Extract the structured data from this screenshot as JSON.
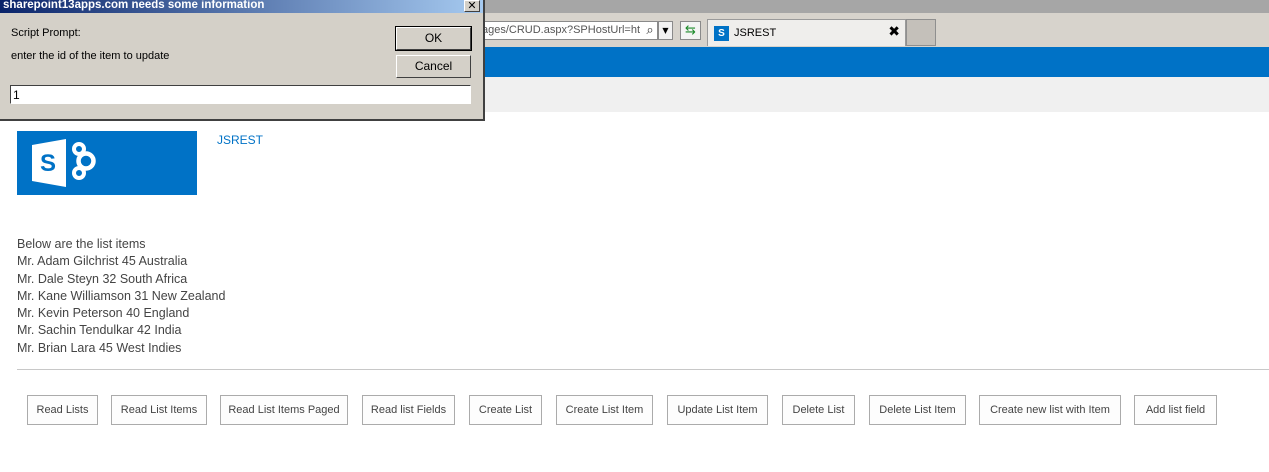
{
  "browser": {
    "address_text": "ages/CRUD.aspx?SPHostUrl=ht",
    "tab_title": "JSREST",
    "tab_icon": "S"
  },
  "page": {
    "site_title": "JSREST",
    "logo_letter": "S",
    "list_heading": "Below are the list items",
    "list_items": [
      "Mr. Adam Gilchrist 45 Australia",
      "Mr. Dale Steyn 32 South Africa",
      "Mr. Kane Williamson 31 New Zealand",
      "Mr. Kevin Peterson 40 England",
      "Mr. Sachin Tendulkar 42 India",
      "Mr. Brian Lara 45 West Indies"
    ],
    "buttons": [
      "Read Lists",
      "Read List Items",
      "Read List Items Paged",
      "Read list Fields",
      "Create List",
      "Create List Item",
      "Update List Item",
      "Delete List",
      "Delete List Item",
      "Create new list with Item",
      "Add list field"
    ]
  },
  "dialog": {
    "title": "sharepoint13apps.com needs some information",
    "prompt_label": "Script Prompt:",
    "message": "enter the id of the item to update",
    "input_value": "1",
    "ok_label": "OK",
    "cancel_label": "Cancel"
  },
  "colors": {
    "sharepoint_blue": "#0072c6",
    "dialog_gray": "#d4d0c8"
  }
}
